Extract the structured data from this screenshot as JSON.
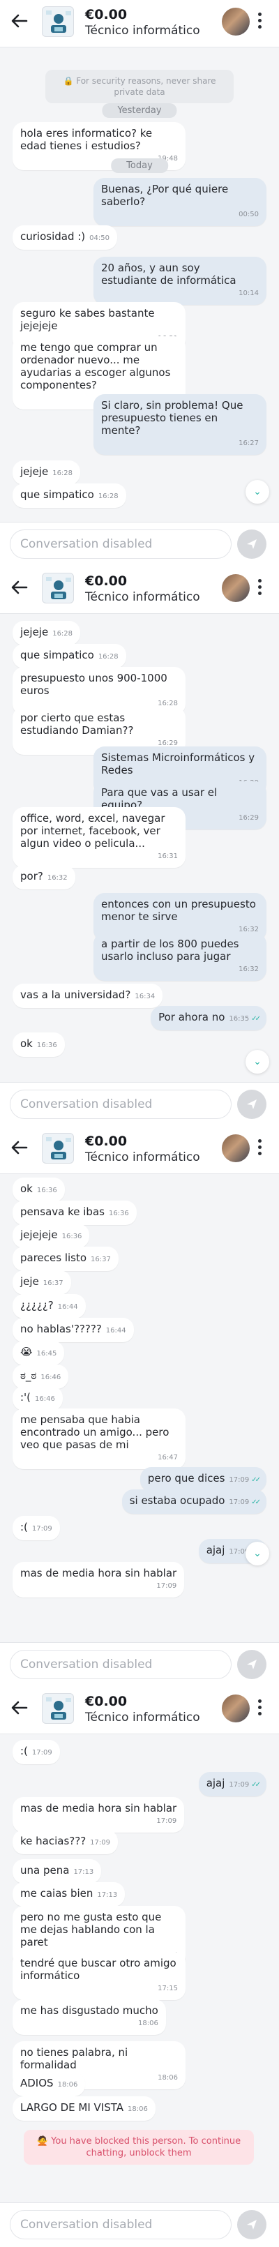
{
  "product": {
    "price": "€0.00",
    "title": "Técnico informático"
  },
  "composer": {
    "placeholder": "Conversation disabled"
  },
  "panels": [
    {
      "items": [
        {
          "kind": "notice",
          "text": "🔒 For security reasons, never share private data"
        },
        {
          "kind": "sep",
          "text": "Yesterday"
        },
        {
          "kind": "msg",
          "side": "in",
          "text": "hola eres informatico? ke edad tienes i estudios?",
          "time": "19:48"
        },
        {
          "kind": "sep",
          "text": "Today"
        },
        {
          "kind": "msg",
          "side": "out",
          "text": "Buenas, ¿Por qué quiere saberlo?",
          "time": "00:50"
        },
        {
          "kind": "msg",
          "side": "in",
          "text": "curiosidad :)",
          "time": "04:50"
        },
        {
          "kind": "msg",
          "side": "out",
          "text": "20 años, y aun soy estudiante de informática",
          "time": "10:14"
        },
        {
          "kind": "msg",
          "side": "in",
          "text": "seguro ke sabes bastante jejejeje",
          "time": "16:21"
        },
        {
          "kind": "msg",
          "side": "in",
          "text": "me tengo que comprar un ordenador nuevo... me ayudarias a escoger algunos componentes?",
          "time": "16:22"
        },
        {
          "kind": "msg",
          "side": "out",
          "text": "Si claro, sin problema! Que presupuesto tienes en mente?",
          "time": "16:27"
        },
        {
          "kind": "msg",
          "side": "in",
          "text": "jejeje",
          "time": "16:28"
        },
        {
          "kind": "msg",
          "side": "in",
          "text": "que simpatico",
          "time": "16:28"
        }
      ]
    },
    {
      "items": [
        {
          "kind": "msg",
          "side": "in",
          "text": "jejeje",
          "time": "16:28"
        },
        {
          "kind": "msg",
          "side": "in",
          "text": "que simpatico",
          "time": "16:28"
        },
        {
          "kind": "msg",
          "side": "in",
          "text": "presupuesto unos 900-1000 euros",
          "time": "16:28"
        },
        {
          "kind": "msg",
          "side": "in",
          "text": "por cierto que estas estudiando Damian??",
          "time": "16:29"
        },
        {
          "kind": "msg",
          "side": "out",
          "text": "Sistemas Microinformáticos y Redes",
          "time": "16:29"
        },
        {
          "kind": "msg",
          "side": "out",
          "text": "Para que vas a usar el equipo?",
          "time": "16:29"
        },
        {
          "kind": "msg",
          "side": "in",
          "text": "office, word, excel, navegar por internet, facebook, ver algun video o pelicula...",
          "time": "16:31"
        },
        {
          "kind": "msg",
          "side": "in",
          "text": "por?",
          "time": "16:32"
        },
        {
          "kind": "msg",
          "side": "out",
          "text": "entonces con un presupuesto menor te sirve",
          "time": "16:32"
        },
        {
          "kind": "msg",
          "side": "out",
          "text": "a partir de los 800 puedes usarlo incluso para jugar",
          "time": "16:32"
        },
        {
          "kind": "msg",
          "side": "in",
          "text": "vas a la universidad?",
          "time": "16:34"
        },
        {
          "kind": "msg",
          "side": "out",
          "text": "Por ahora no",
          "time": "16:35"
        },
        {
          "kind": "msg",
          "side": "in",
          "text": "ok",
          "time": "16:36"
        }
      ]
    },
    {
      "items": [
        {
          "kind": "msg",
          "side": "in",
          "text": "ok",
          "time": "16:36"
        },
        {
          "kind": "msg",
          "side": "in",
          "text": "pensava ke ibas",
          "time": "16:36"
        },
        {
          "kind": "msg",
          "side": "in",
          "text": "jejejeje",
          "time": "16:36"
        },
        {
          "kind": "msg",
          "side": "in",
          "text": "pareces listo",
          "time": "16:37"
        },
        {
          "kind": "msg",
          "side": "in",
          "text": "jeje",
          "time": "16:37"
        },
        {
          "kind": "msg",
          "side": "in",
          "text": "¿¿¿¿¿?",
          "time": "16:44"
        },
        {
          "kind": "msg",
          "side": "in",
          "text": "no hablas'?????",
          "time": "16:44"
        },
        {
          "kind": "msg",
          "side": "in",
          "text": "😭",
          "time": "16:45"
        },
        {
          "kind": "msg",
          "side": "in",
          "text": "ಠ_ಠ",
          "time": "16:46"
        },
        {
          "kind": "msg",
          "side": "in",
          "text": ":'(",
          "time": "16:46"
        },
        {
          "kind": "msg",
          "side": "in",
          "text": "me pensaba que habia encontrado un amigo... pero veo que pasas de mi",
          "time": "16:47"
        },
        {
          "kind": "msg",
          "side": "out",
          "text": "pero que dices",
          "time": "17:09"
        },
        {
          "kind": "msg",
          "side": "out",
          "text": "si estaba ocupado",
          "time": "17:09"
        },
        {
          "kind": "msg",
          "side": "in",
          "text": ":(",
          "time": "17:09"
        },
        {
          "kind": "msg",
          "side": "out",
          "text": "ajaj",
          "time": "17:09"
        },
        {
          "kind": "msg",
          "side": "in",
          "text": "mas de media hora sin hablar",
          "time": "17:09"
        }
      ]
    },
    {
      "items": [
        {
          "kind": "msg",
          "side": "in",
          "text": ":(",
          "time": "17:09"
        },
        {
          "kind": "msg",
          "side": "out",
          "text": "ajaj",
          "time": "17:09"
        },
        {
          "kind": "msg",
          "side": "in",
          "text": "mas de media hora sin hablar",
          "time": "17:09"
        },
        {
          "kind": "msg",
          "side": "in",
          "text": "ke hacias???",
          "time": "17:09"
        },
        {
          "kind": "msg",
          "side": "in",
          "text": "una pena",
          "time": "17:13"
        },
        {
          "kind": "msg",
          "side": "in",
          "text": "me caias bien",
          "time": "17:13"
        },
        {
          "kind": "msg",
          "side": "in",
          "text": "pero no me gusta esto que me dejas hablando con la paret",
          "time": "17:14"
        },
        {
          "kind": "msg",
          "side": "in",
          "text": "tendré que buscar otro amigo informático",
          "time": "17:15"
        },
        {
          "kind": "msg",
          "side": "in",
          "text": "me has disgustado mucho",
          "time": "18:06"
        },
        {
          "kind": "msg",
          "side": "in",
          "text": "no tienes palabra, ni formalidad",
          "time": "18:06"
        },
        {
          "kind": "msg",
          "side": "in",
          "text": "ADIOS",
          "time": "18:06"
        },
        {
          "kind": "msg",
          "side": "in",
          "text": "LARGO DE MI VISTA",
          "time": "18:06"
        },
        {
          "kind": "blocked",
          "text": "🙅 You have blocked this person. To continue chatting, unblock them"
        }
      ]
    }
  ]
}
